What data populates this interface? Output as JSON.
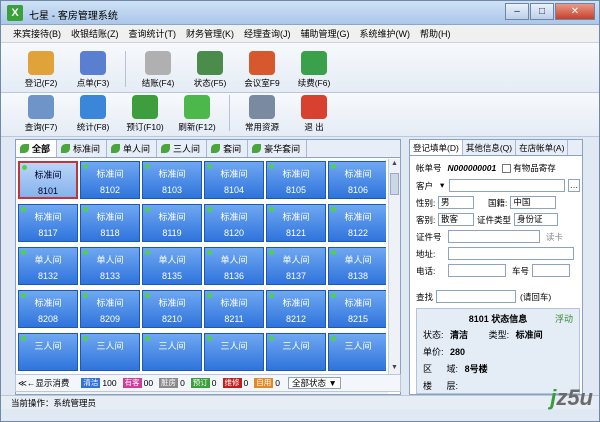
{
  "window": {
    "title": "七星 - 客房管理系统",
    "icon_text": "X",
    "btn_min": "–",
    "btn_max": "□",
    "btn_close": "✕"
  },
  "menu": [
    "来宾接待(B)",
    "收银结账(Z)",
    "查询统计(T)",
    "财务管理(K)",
    "经理查询(J)",
    "辅助管理(G)",
    "系统维护(W)",
    "帮助(H)"
  ],
  "toolbar1": [
    {
      "label": "登记(F2)",
      "icon": "register-icon",
      "color": "#e2a23a"
    },
    {
      "label": "点单(F3)",
      "icon": "order-icon",
      "color": "#5a7fd0"
    },
    {
      "label": "结账(F4)",
      "icon": "checkout-icon",
      "color": "#b0b0b0"
    },
    {
      "label": "状态(F5)",
      "icon": "status-icon",
      "color": "#4a8c4a"
    },
    {
      "label": "会议室F9",
      "icon": "meeting-room-icon",
      "color": "#d8582e"
    },
    {
      "label": "续费(F6)",
      "icon": "renew-icon",
      "color": "#3aa04a"
    }
  ],
  "toolbar2": [
    {
      "label": "查询(F7)",
      "icon": "search-icon",
      "color": "#6e94c8"
    },
    {
      "label": "统计(F8)",
      "icon": "stats-icon",
      "color": "#3a86d8"
    },
    {
      "label": "预订(F10)",
      "icon": "reserve-icon",
      "color": "#3e9e3e"
    },
    {
      "label": "刷新(F12)",
      "icon": "refresh-icon",
      "color": "#4cb84c"
    },
    {
      "label": "常用资源",
      "icon": "resource-icon",
      "color": "#7a8aa0"
    },
    {
      "label": "退  出",
      "icon": "exit-icon",
      "color": "#d84030"
    }
  ],
  "room_tabs": [
    "全部",
    "标准间",
    "单人间",
    "三人间",
    "套间",
    "豪华套间"
  ],
  "rooms": [
    [
      "标准间",
      "8101"
    ],
    [
      "标准间",
      "8102"
    ],
    [
      "标准间",
      "8103"
    ],
    [
      "标准间",
      "8104"
    ],
    [
      "标准间",
      "8105"
    ],
    [
      "标准间",
      "8106"
    ],
    [
      "标准间",
      "8117"
    ],
    [
      "标准间",
      "8118"
    ],
    [
      "标准间",
      "8119"
    ],
    [
      "标准间",
      "8120"
    ],
    [
      "标准间",
      "8121"
    ],
    [
      "标准间",
      "8122"
    ],
    [
      "单人间",
      "8132"
    ],
    [
      "单人间",
      "8133"
    ],
    [
      "单人间",
      "8135"
    ],
    [
      "单人间",
      "8136"
    ],
    [
      "单人间",
      "8137"
    ],
    [
      "单人间",
      "8138"
    ],
    [
      "标准间",
      "8208"
    ],
    [
      "标准间",
      "8209"
    ],
    [
      "标准间",
      "8210"
    ],
    [
      "标准间",
      "8211"
    ],
    [
      "标准间",
      "8212"
    ],
    [
      "标准间",
      "8215"
    ],
    [
      "三人间",
      ""
    ],
    [
      "三人间",
      ""
    ],
    [
      "三人间",
      ""
    ],
    [
      "三人间",
      ""
    ],
    [
      "三人间",
      ""
    ],
    [
      "三人间",
      ""
    ]
  ],
  "status_bar": {
    "toggle": "≪←显示消费",
    "legend": [
      {
        "label": "清洁",
        "count": "100",
        "color": "#2f74dc"
      },
      {
        "label": "有客",
        "count": "00",
        "color": "#d03c9a"
      },
      {
        "label": "脏房",
        "count": "0",
        "color": "#8a8a8a"
      },
      {
        "label": "预订",
        "count": "0",
        "color": "#3aa03a"
      },
      {
        "label": "维修",
        "count": "0",
        "color": "#c02020"
      },
      {
        "label": "自用",
        "count": "0",
        "color": "#e08a2a"
      }
    ],
    "filter": "全部状态"
  },
  "bottom": "当前操作：系统管理员",
  "right_tabs": [
    "登记填单(D)",
    "其他信息(Q)",
    "在店帐单(A)"
  ],
  "form": {
    "account_label": "帐单号",
    "account_value": "N000000001",
    "deposit_label": "有物品寄存",
    "guest_label": "客户",
    "gender_label": "性别:",
    "gender_value": "男",
    "nation_label": "国籍:",
    "nation_value": "中国",
    "kind_label": "客别:",
    "kind_value": "散客",
    "idtype_label": "证件类型",
    "idtype_value": "身份证",
    "idno_label": "证件号",
    "readcard": "读卡",
    "address_label": "地址:",
    "phone_label": "电话:",
    "plate_label": "车号",
    "find_label": "查找",
    "find_hint": "(请回车)"
  },
  "info": {
    "title": "8101 状态信息",
    "float": "浮动",
    "state_label": "状态:",
    "state_value": "清洁",
    "type_label": "类型:",
    "type_value": "标准间",
    "price_label": "单价:",
    "price_value": "280",
    "area_label": "区",
    "area_mid": "域:",
    "area_value": "8号楼",
    "floor_label": "楼",
    "floor_mid": "层:"
  },
  "watermark": "jz5u"
}
